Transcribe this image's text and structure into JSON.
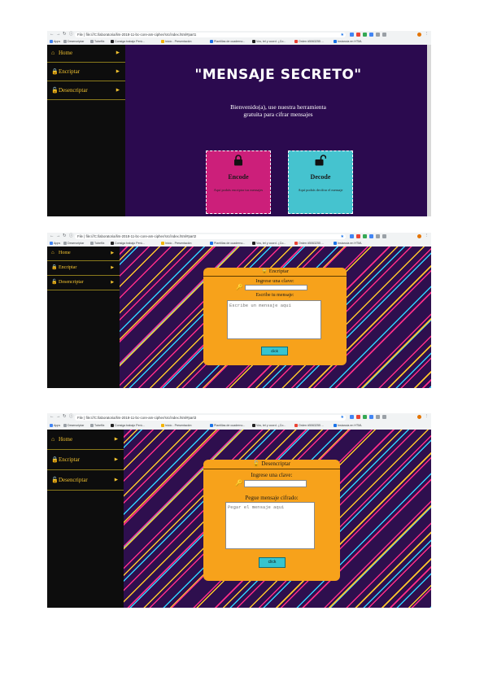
{
  "shots": [
    {
      "url": "file:///C:/laboratoria/lim-2018-11-bc-core-am-cipher/src/index.html#part1",
      "title": "\"MENSAJE SECRETO\"",
      "welcome_line1": "Bienvenido(a), use nuestra herramienta",
      "welcome_line2": "gratuita para cifrar mensajes",
      "encode": {
        "title": "Encode",
        "desc": "Aquí podrás encriptar tus mensajes"
      },
      "decode": {
        "title": "Decode",
        "desc": "Aquí podrás decifrar el mensaje"
      }
    },
    {
      "url": "file:///C:/laboratoria/lim-2018-11-bc-core-am-cipher/src/index.html#part2",
      "panel_title": "Encriptar",
      "key_label": "Ingrese una clave:",
      "msg_label": "Escribe tu mensaje:",
      "msg_placeholder": "Escribe un mensaje aqui",
      "button": "click"
    },
    {
      "url": "file:///C:/laboratoria/lim-2018-11-bc-core-am-cipher/src/index.html#part3",
      "panel_title": "Desencriptar",
      "key_label": "Ingrese una clave:",
      "msg_label": "Pegue mensaje cifrado:",
      "msg_placeholder": "Pegar el mensaje aqui",
      "button": "click"
    }
  ],
  "browser": {
    "file_label": "File",
    "bookmarks": [
      "Apps",
      "Desencriptar",
      "Tubeflix",
      "Consiga trabajo Perú...",
      "Inicio - Presentación",
      "Plantillas de cuaderno...",
      "Vos, tel y coord. ¿Co...",
      "Orden #5063255 ...",
      "Instancia en HTML"
    ]
  },
  "sidebar": {
    "items": [
      {
        "label": "Home",
        "icon": "home-icon"
      },
      {
        "label": "Encriptar",
        "icon": "lock-icon"
      },
      {
        "label": "Desencriptar",
        "icon": "unlock-icon"
      }
    ]
  },
  "colors": {
    "sidebar_bg": "#0d0d0d",
    "sidebar_text": "#f4c430",
    "purple": "#2b0a4f",
    "encode_card": "#cc1f7a",
    "decode_card": "#45c3cf",
    "panel": "#f7a21b",
    "button": "#37c4cf"
  }
}
